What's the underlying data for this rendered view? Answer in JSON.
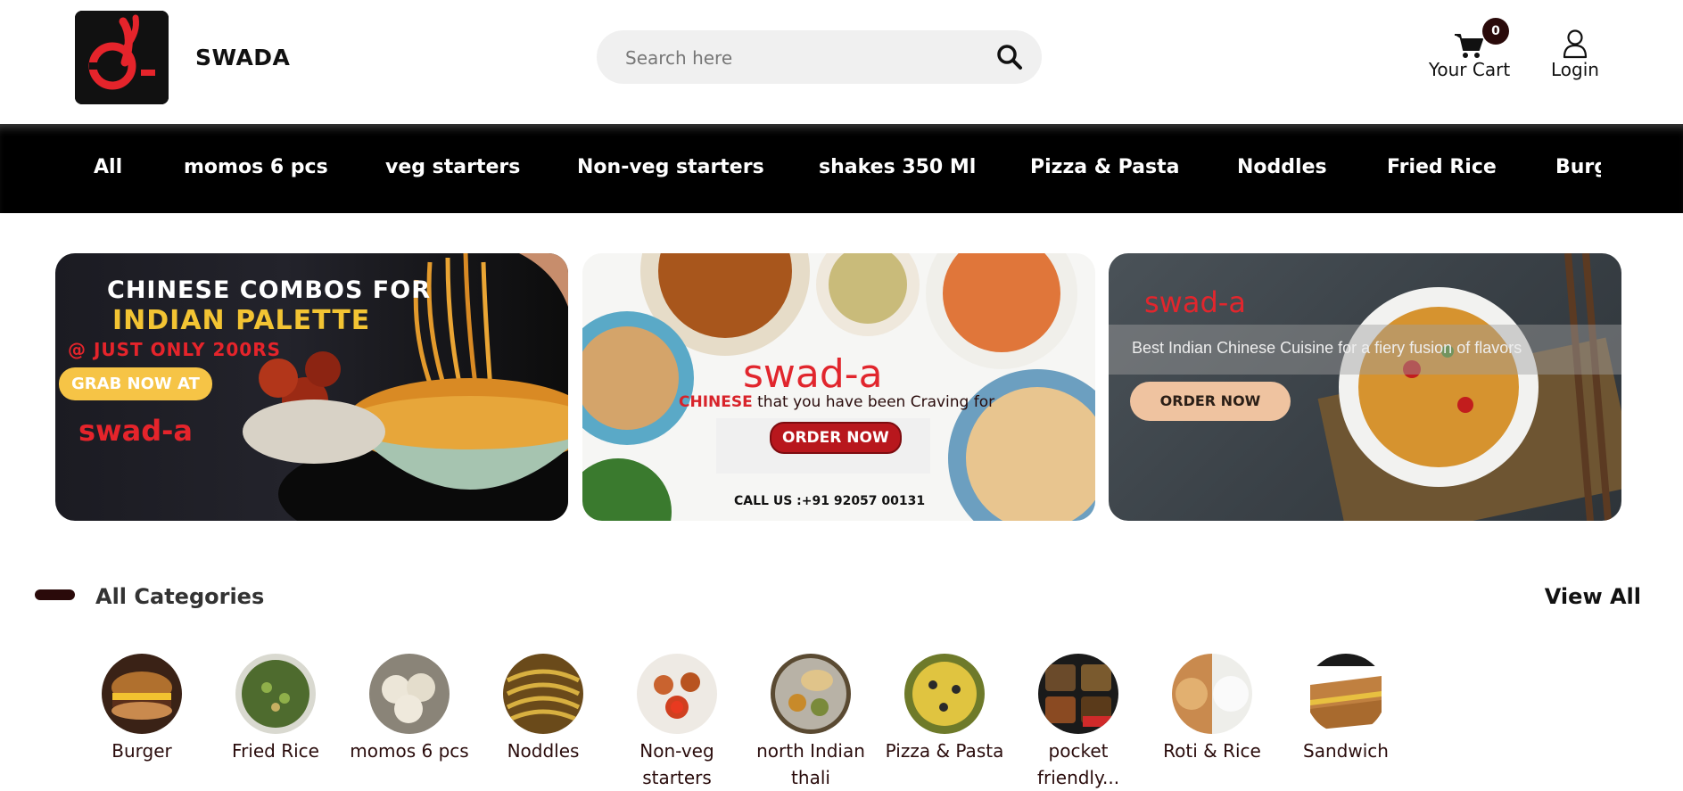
{
  "header": {
    "brand": "SWADA",
    "search_placeholder": "Search here",
    "cart_count": "0",
    "cart_label": "Your Cart",
    "login_label": "Login"
  },
  "nav": {
    "items": [
      "All",
      "momos 6 pcs",
      "veg starters",
      "Non-veg starters",
      "shakes 350 Ml",
      "Pizza & Pasta",
      "Noddles",
      "Fried Rice",
      "Burger"
    ]
  },
  "banners": [
    {
      "line1": "CHINESE COMBOS FOR",
      "line2": "INDIAN PALETTE",
      "line3": "@ JUST ONLY 200RS",
      "button": "GRAB NOW AT",
      "brand": "swad-a"
    },
    {
      "brand": "swad-a",
      "tag_highlight": "CHINESE",
      "tag_rest": " that you have been Craving for",
      "button": "ORDER NOW",
      "call": "CALL US :+91 92057 00131"
    },
    {
      "brand": "swad-a",
      "tagline": "Best Indian Chinese Cuisine for a fiery fusion of flavors",
      "button": "ORDER NOW"
    }
  ],
  "categories": {
    "title": "All Categories",
    "view_all": "View All",
    "items": [
      {
        "label": "Burger",
        "color": "#7a4a22"
      },
      {
        "label": "Fried Rice",
        "color": "#4e6b2e"
      },
      {
        "label": "momos 6 pcs",
        "color": "#d9d2c4"
      },
      {
        "label": "Noddles",
        "color": "#b08a2a"
      },
      {
        "label": "Non-veg starters",
        "color": "#c9632f"
      },
      {
        "label": "north Indian thali",
        "color": "#8c7a52"
      },
      {
        "label": "Pizza & Pasta",
        "color": "#c8b03a"
      },
      {
        "label": "pocket friendly...",
        "color": "#3a2a1a"
      },
      {
        "label": "Roti & Rice",
        "color": "#c98a4e"
      },
      {
        "label": "Sandwich",
        "color": "#b0702e"
      }
    ]
  },
  "colors": {
    "brand_red": "#e1262d",
    "dark_maroon": "#2a0a0a",
    "nav_bg": "#000000"
  }
}
